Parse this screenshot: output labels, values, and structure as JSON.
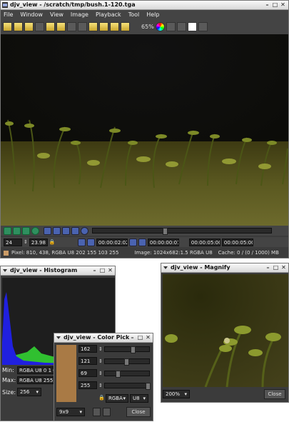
{
  "main": {
    "title": "djv_view - /scratch/tmp/bush.1-120.tga",
    "menu": [
      "File",
      "Window",
      "View",
      "Image",
      "Playback",
      "Tool",
      "Help"
    ],
    "zoom": "65%",
    "frame_input": "24",
    "speed": "23.98",
    "time_current": "00:00:02:02",
    "time_in": "00:00:00:01",
    "time_out1": "00:00:05:00",
    "time_out2": "00:00:05:00",
    "pixel_info": "Pixel: 810, 438, RGBA U8 202 155 103 255",
    "image_info": "Image: 1024x682:1.5 RGBA U8",
    "cache_info": "Cache: 0 / (0 / 1000) MB",
    "playhead_fraction": 0.4
  },
  "histogram": {
    "title": "djv_view - Histogram",
    "min_label": "Min:",
    "min_value": "RGBA U8 0 1 0",
    "max_label": "Max:",
    "max_value": "RGBA U8 255 2",
    "size_label": "Size:",
    "size_value": "256"
  },
  "magnify": {
    "title": "djv_view - Magnify",
    "zoom": "200%",
    "close": "Close"
  },
  "colorpicker": {
    "title": "djv_view - Color Picker",
    "values": [
      "162",
      "121",
      "69",
      "255"
    ],
    "levels": [
      0.635,
      0.475,
      0.27,
      1.0
    ],
    "format": "RGBA",
    "type": "U8",
    "size": "9x9",
    "close": "Close",
    "swatch": "#a97a45"
  }
}
